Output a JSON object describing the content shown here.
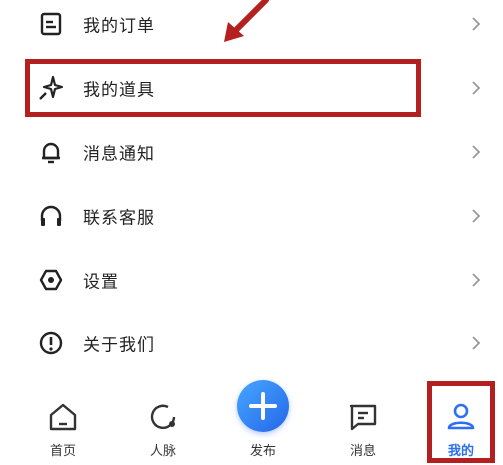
{
  "menu": {
    "items": [
      {
        "label": "我的订单",
        "icon": "order-icon"
      },
      {
        "label": "我的道具",
        "icon": "sparkle-icon"
      },
      {
        "label": "消息通知",
        "icon": "bell-icon"
      },
      {
        "label": "联系客服",
        "icon": "headset-icon"
      },
      {
        "label": "设置",
        "icon": "settings-icon"
      },
      {
        "label": "关于我们",
        "icon": "info-icon"
      }
    ]
  },
  "tabbar": {
    "items": [
      {
        "label": "首页",
        "icon": "home-icon"
      },
      {
        "label": "人脉",
        "icon": "network-icon"
      },
      {
        "label": "发布",
        "icon": "plus-icon"
      },
      {
        "label": "消息",
        "icon": "message-icon"
      },
      {
        "label": "我的",
        "icon": "profile-icon"
      }
    ],
    "active": "我的"
  },
  "colors": {
    "accent": "#2d6ff2",
    "highlight": "#b3201f",
    "text": "#222222"
  }
}
